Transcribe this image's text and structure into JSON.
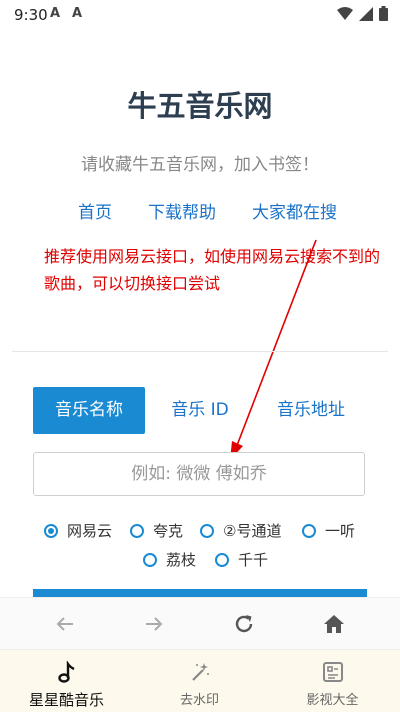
{
  "status_bar": {
    "time": "9:30",
    "notif1": "A",
    "notif2": "A"
  },
  "page": {
    "title": "牛五音乐网",
    "subtitle": "请收藏牛五音乐网，加入书签！",
    "links": [
      "首页",
      "下载帮助",
      "大家都在搜"
    ],
    "notice": "推荐使用网易云接口，如使用网易云搜索不到的歌曲，可以切换接口尝试"
  },
  "tabs": [
    "音乐名称",
    "音乐 ID",
    "音乐地址"
  ],
  "search": {
    "placeholder": "例如: 微微 傅如乔"
  },
  "sources": {
    "options": [
      "网易云",
      "夸克",
      "②号通道",
      "一听",
      "荔枝",
      "千千"
    ],
    "selected": "网易云"
  },
  "bottom_nav": {
    "items": [
      "星星酷音乐",
      "去水印",
      "影视大全"
    ],
    "active": "星星酷音乐"
  },
  "colors": {
    "accent": "#1a8bd2",
    "notice": "#e00000",
    "title": "#2c3e50"
  }
}
